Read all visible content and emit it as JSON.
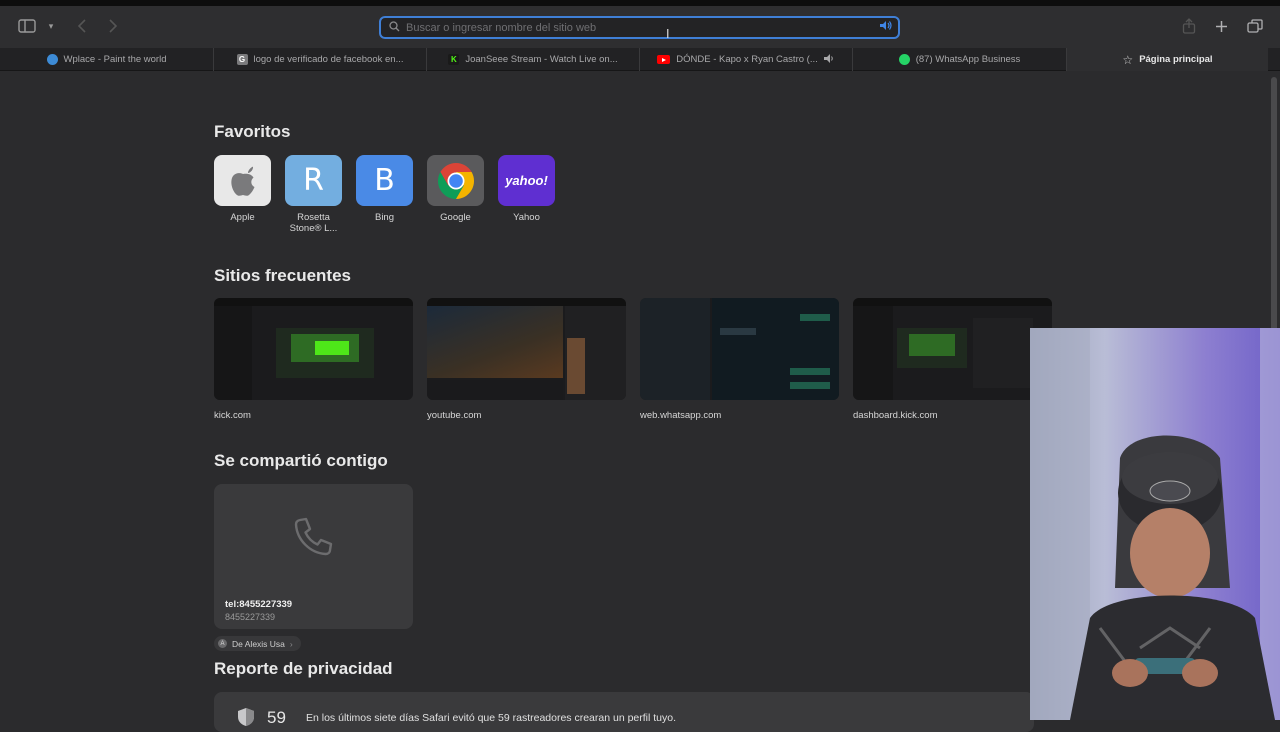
{
  "address_bar": {
    "placeholder": "Buscar o ingresar nombre del sitio web"
  },
  "tabs": [
    {
      "title": "Wplace - Paint the world",
      "favicon": "globe-icon",
      "color": "#3d8bd6"
    },
    {
      "title": "logo de verificado de facebook en...",
      "favicon": "G",
      "color": "#7a7a7c"
    },
    {
      "title": "JoanSeee Stream - Watch Live on...",
      "favicon": "K",
      "color": "#53fc18"
    },
    {
      "title": "DÓNDE - Kapo x Ryan Castro (...",
      "favicon": "youtube-icon",
      "color": "#ff0000"
    },
    {
      "title": "(87) WhatsApp Business",
      "favicon": "whatsapp-icon",
      "color": "#25d366"
    },
    {
      "title": "Página principal",
      "favicon": "star-icon",
      "color": "#e8e8e8"
    }
  ],
  "favorites": {
    "title": "Favoritos",
    "items": [
      {
        "label": "Apple",
        "glyph": "",
        "bg": "#e8e8e8"
      },
      {
        "label": "Rosetta Stone® L...",
        "glyph": "R",
        "bg": "#73aee0"
      },
      {
        "label": "Bing",
        "glyph": "B",
        "bg": "#4a8ae6"
      },
      {
        "label": "Google",
        "glyph": "",
        "bg": "#5a5a5c"
      },
      {
        "label": "Yahoo",
        "glyph": "yahoo!",
        "bg": "#5f2fd1"
      }
    ]
  },
  "frequent": {
    "title": "Sitios frecuentes",
    "items": [
      {
        "url": "kick.com"
      },
      {
        "url": "youtube.com"
      },
      {
        "url": "web.whatsapp.com"
      },
      {
        "url": "dashboard.kick.com"
      }
    ]
  },
  "shared": {
    "title": "Se compartió contigo",
    "card_title": "tel:8455227339",
    "card_subtitle": "8455227339",
    "from": "De Alexis Usa",
    "from_initial": "A"
  },
  "privacy": {
    "title": "Reporte de privacidad",
    "count": "59",
    "text": "En los últimos siete días Safari evitó que 59 rastreadores crearan un perfil tuyo."
  }
}
